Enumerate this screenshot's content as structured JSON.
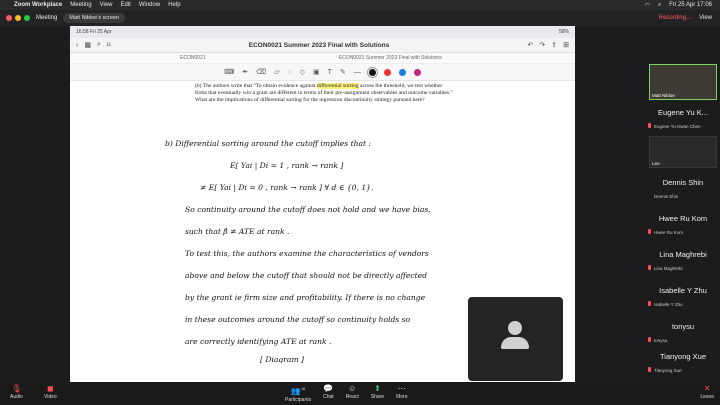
{
  "mac_menu": {
    "apple": "",
    "app": "Zoom Workplace",
    "items": [
      "Meeting",
      "View",
      "Edit",
      "Window",
      "Help"
    ],
    "date_time": "Fri 25 Apr  17:06"
  },
  "zoom_header": {
    "meeting_label": "Meeting",
    "share_pill": "Matt Nibloe's screen",
    "recording": "Recording...",
    "view": "View"
  },
  "ipad_status": {
    "time": "16:58",
    "date": "Fri 25 Apr",
    "battery": "58%"
  },
  "doc": {
    "title": "ECON0021 Summer 2023 Final with Solutions",
    "tab_text": "ECON0021 Summer 2023 Final with Solutions",
    "tab_left": "ECON0021"
  },
  "colors": {
    "accent_green": "#7bd35c",
    "record_red": "#ff5a5a",
    "highlight": "#fff27a"
  },
  "printed_question": {
    "prefix": "(b) The authors write that \"To obtain evidence against ",
    "highlight": "differential sorting",
    "suffix": " across the threshold, we test whether firms that eventually win a grant are different in terms of their pre-assignment observables and outcome variables.\" What are the implications of differential sorting for the regression discontinuity strategy pursued here?"
  },
  "handwriting": [
    "b)   Differential sorting   around   the  cutoff  implies  that :",
    "E[ Yai | Di = 1 ,  rank → rank ]",
    "≠     E[ Yai | Di = 0 ,  rank → rank ]      ∀  d ∈ {0, 1}.",
    "So  continuity  around  the  cutoff  does  not  hold  and  we  have  bias,",
    "such   that       β̂   ≠   ATE  at   rank .",
    "To  test  this,  the  authors  examine  the  characteristics  of  vendors",
    "above  and  below  the  cutoff  that  should  not  be  directly  affected",
    "by  the  grant  ie  firm  size  and  profitability.   If  there  is  no  change",
    "in  these  outcomes  around  the  cutoff  so  continuity  holds  so",
    "are  correctly  identifying   ATE  at   rank .",
    "[ Diagram ]"
  ],
  "participants": [
    {
      "name": "Matt Nibloe",
      "video": true
    },
    {
      "name": "Eugene Yu K...",
      "sub": "Eugene Yu Kwan Chen"
    },
    {
      "name": "Leo",
      "video": true
    },
    {
      "name": "Dennis Shin",
      "sub": "Dennis Shin"
    },
    {
      "name": "Hwee Ru Kom",
      "sub": "Hwee Ru Kom"
    },
    {
      "name": "Lina Maghrebi",
      "sub": "Lina Maghrebi"
    },
    {
      "name": "Isabelle Y Zhu",
      "sub": "Isabelle Y Zhu"
    },
    {
      "name": "tonysu",
      "sub": "tonysu"
    },
    {
      "name": "Tianyong Xue",
      "sub": "Tianyong Xue"
    }
  ],
  "bottom": {
    "audio": "Audio",
    "video": "Video",
    "participants": "Participants",
    "participants_count": "16",
    "chat": "Chat",
    "react": "React",
    "share": "Share",
    "more": "More",
    "leave": "Leave"
  }
}
